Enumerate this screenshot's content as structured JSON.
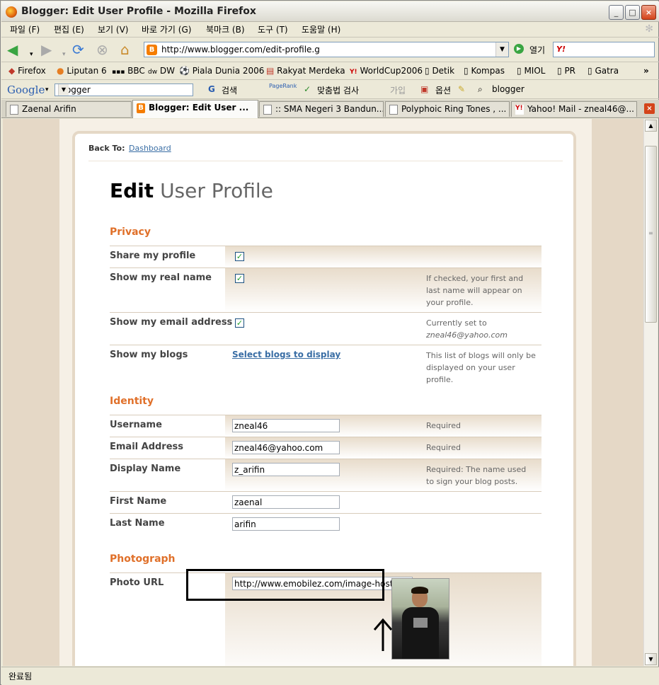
{
  "window": {
    "title": "Blogger: Edit User Profile - Mozilla Firefox"
  },
  "menu": [
    "파일 (F)",
    "편집 (E)",
    "보기 (V)",
    "바로 가기 (G)",
    "북마크 (B)",
    "도구 (T)",
    "도움말 (H)"
  ],
  "nav": {
    "url": "http://www.blogger.com/edit-profile.g",
    "go_label": "열기",
    "search_logo": "Y!"
  },
  "bookmarks": [
    "Firefox",
    "Liputan 6",
    "BBC",
    "DW",
    "Piala Dunia 2006",
    "Rakyat Merdeka",
    "WorldCup2006",
    "Detik",
    "Kompas",
    "MIOL",
    "PR",
    "Gatra"
  ],
  "google_bar": {
    "logo": "Google",
    "query": "blogger",
    "search_label": "검색",
    "pagerank_label": "PageRank",
    "spell_label": "맞춤법 검사",
    "signin_label": "가입",
    "options_label": "옵션",
    "find_label": "blogger"
  },
  "tabs": [
    "Zaenal Arifin",
    "Blogger: Edit User ...",
    ":: SMA Negeri 3 Bandun...",
    "Polyphoic Ring Tones , ...",
    "Yahoo! Mail - zneal46@..."
  ],
  "page": {
    "back_to_label": "Back To:",
    "back_to_link": "Dashboard",
    "title_bold": "Edit",
    "title_rest": "User Profile",
    "privacy": {
      "heading": "Privacy",
      "share_label": "Share my profile",
      "share_checked": true,
      "realname_label": "Show my real name",
      "realname_checked": true,
      "realname_hint": "If checked, your first and last name will appear on your profile.",
      "email_label": "Show my email address",
      "email_checked": true,
      "email_hint": "Currently set to",
      "email_hint_value": "zneal46@yahoo.com",
      "blogs_label": "Show my blogs",
      "blogs_link": "Select blogs to display",
      "blogs_hint": "This list of blogs will only be displayed on your user profile."
    },
    "identity": {
      "heading": "Identity",
      "username_label": "Username",
      "username_value": "zneal46",
      "username_hint": "Required",
      "email_label": "Email Address",
      "email_value": "zneal46@yahoo.com",
      "email_hint": "Required",
      "display_label": "Display Name",
      "display_value": "z_arifin",
      "display_hint": "Required: The name used to sign your blog posts.",
      "first_label": "First Name",
      "first_value": "zaenal",
      "last_label": "Last Name",
      "last_value": "arifin"
    },
    "photograph": {
      "heading": "Photograph",
      "url_label": "Photo URL",
      "url_value": "http://www.emobilez.com/image-host/fil"
    }
  },
  "status": {
    "text": "완료됨"
  }
}
